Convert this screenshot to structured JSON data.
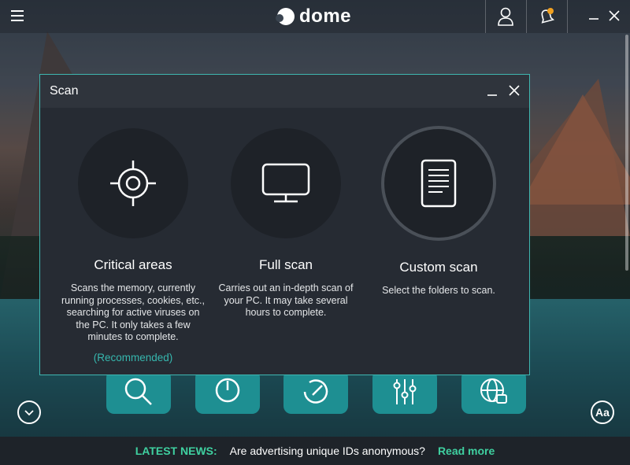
{
  "app": {
    "logo_text": "dome",
    "brand_color": "#1e8f92",
    "accent_color": "#3fd0a0"
  },
  "topbar": {
    "menu_icon": "hamburger-menu-icon",
    "user_icon": "user-icon",
    "notification_icon": "bell-icon",
    "minimize_icon": "minimize-icon",
    "close_icon": "close-icon"
  },
  "dialog": {
    "title": "Scan",
    "options": [
      {
        "icon": "crosshair-icon",
        "title": "Critical areas",
        "description": "Scans the memory, currently running processes, cookies, etc., searching for active viruses on the PC. It only takes a few minutes to complete.",
        "recommended": "(Recommended)"
      },
      {
        "icon": "monitor-icon",
        "title": "Full scan",
        "description": "Carries out an in-depth scan of your PC. It may take several hours to complete."
      },
      {
        "icon": "document-icon",
        "title": "Custom scan",
        "description": "Select the folders to scan."
      }
    ]
  },
  "dock": {
    "tiles": [
      "search-icon",
      "power-icon",
      "refresh-icon",
      "sliders-icon",
      "globe-lock-icon"
    ],
    "left_button_icon": "chevron-down-icon",
    "right_button_label": "Aa"
  },
  "news": {
    "label": "LATEST NEWS:",
    "text": "Are advertising unique IDs anonymous?",
    "link": "Read more"
  }
}
